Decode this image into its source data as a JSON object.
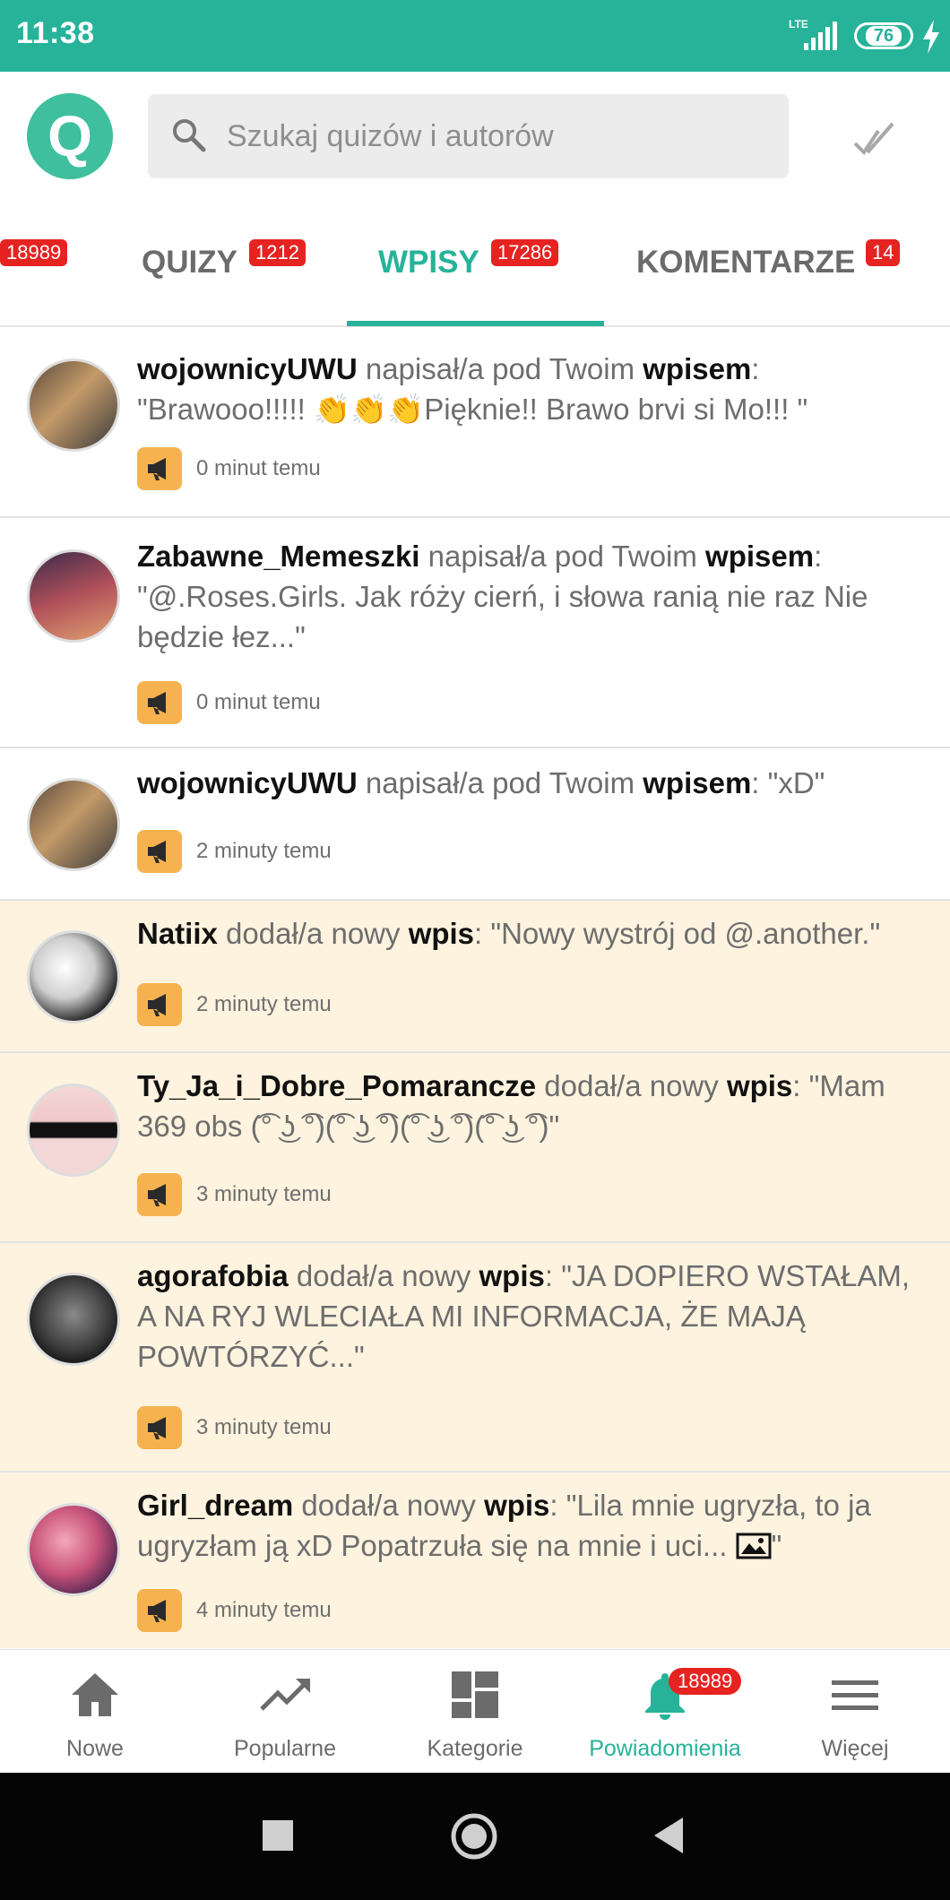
{
  "status_bar": {
    "time": "11:38",
    "network": "LTE",
    "battery": "76"
  },
  "search": {
    "placeholder": "Szukaj quizów i autorów"
  },
  "tabs": [
    {
      "label": "",
      "badge": "18989"
    },
    {
      "label": "QUIZY",
      "badge": "1212"
    },
    {
      "label": "WPISY",
      "badge": "17286",
      "active": true
    },
    {
      "label": "KOMENTARZE",
      "badge": "14"
    }
  ],
  "notifications": [
    {
      "user": "wojownicyUWU",
      "action": " napisał/a pod Twoim ",
      "target": "wpisem",
      "text": ":  \"Brawooo!!!!! 👏👏👏Pięknie!! Brawo brvi si Mo!!! \"",
      "time": "0 minut temu",
      "unread": false
    },
    {
      "user": "Zabawne_Memeszki",
      "action": " napisał/a pod Twoim ",
      "target": "wpisem",
      "text": ": \"@.Roses.Girls. Jak róży cierń, i słowa ranią nie raz Nie będzie łez...\"",
      "time": "0 minut temu",
      "unread": false
    },
    {
      "user": "wojownicyUWU",
      "action": " napisał/a pod Twoim ",
      "target": "wpisem",
      "text": ": \"xD\"",
      "time": "2 minuty temu",
      "unread": false
    },
    {
      "user": "Natiix",
      "action": " dodał/a nowy ",
      "target": "wpis",
      "text": ": \"Nowy wystrój od @.another.\"",
      "time": "2 minuty temu",
      "unread": true
    },
    {
      "user": "Ty_Ja_i_Dobre_Pomarancze",
      "action": " dodał/a nowy ",
      "target": "wpis",
      "text": ": \"Mam 369 obs (͡° ͜ʖ ͡°)(͡° ͜ʖ ͡°)(͡° ͜ʖ ͡°)(͡° ͜ʖ ͡°)\"",
      "time": "3 minuty temu",
      "unread": true
    },
    {
      "user": "agorafobia",
      "action": " dodał/a nowy ",
      "target": "wpis",
      "text": ": \"JA DOPIERO WSTAŁAM, A NA RYJ WLECIAŁA MI INFORMACJA, ŻE MAJĄ POWTÓRZYĆ...\"",
      "time": "3 minuty temu",
      "unread": true
    },
    {
      "user": "Girl_dream",
      "action": " dodał/a nowy ",
      "target": "wpis",
      "text": ": \"Lila mnie ugryzła, to ja ugryzłam ją xD Popatrzuła się na mnie i uci... ",
      "text_end": "\"",
      "time": "4 minuty temu",
      "unread": true
    }
  ],
  "bottom_nav": [
    {
      "label": "Nowe",
      "icon": "home-icon"
    },
    {
      "label": "Popularne",
      "icon": "trending-icon"
    },
    {
      "label": "Kategorie",
      "icon": "dashboard-icon"
    },
    {
      "label": "Powiadomienia",
      "icon": "bell-icon",
      "badge": "18989",
      "active": true
    },
    {
      "label": "Więcej",
      "icon": "menu-icon"
    }
  ],
  "colors": {
    "accent": "#26b399",
    "badge": "#e52320",
    "unread_bg": "#fdf3df",
    "megaphone": "#f6b24f"
  }
}
